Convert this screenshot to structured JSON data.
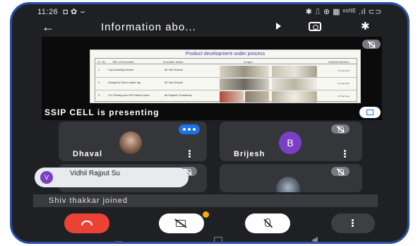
{
  "status_bar": {
    "time": "11:26",
    "left_icons": "◘ ✿ ⌣",
    "right_icons": "✱ ⎍ ⊕ ▦ ᵛᵒˡᵗᴱ .ıl ⊂⊃"
  },
  "app_bar": {
    "back_icon": "arrow-left",
    "title": "Information abo...",
    "icons": [
      "cast-icon",
      "switch-camera-icon",
      "bluetooth-icon"
    ]
  },
  "presentation": {
    "slide_title": "Product development under process",
    "slide_headers": [
      "Sr. No.",
      "Title of innovation",
      "Innovator Name",
      "Images",
      "Guided/ Mentors"
    ],
    "slide_rows": [
      {
        "no": "1",
        "title": "Cup washing Device",
        "innovator": "Mr Har Dhaval",
        "mentor": "Mr Raj Patel"
      },
      {
        "no": "2",
        "title": "Designed Storm water tap",
        "innovator": "Mr Har Dhaval",
        "mentor": "Mr Raj Patel"
      },
      {
        "no": "3",
        "title": "3 D Printing and 3D Printed parts",
        "innovator": "Mr Rajesh Chaudhary",
        "mentor": "Mr Raj Patel"
      }
    ],
    "presenter_label": "SSIP CELL is presenting"
  },
  "participants": [
    {
      "name": "Dhaval",
      "avatar": "photo"
    },
    {
      "name": "Brijesh",
      "avatar_letter": "B"
    },
    {
      "name": "",
      "avatar": "none"
    },
    {
      "name": "",
      "avatar": "photo"
    }
  ],
  "toast": {
    "avatar_letter": "V",
    "text": "Vidhil Rajput Su"
  },
  "joined_notice": "Shiv thakkar joined",
  "controls": [
    "end-call",
    "camera-off",
    "mic-off",
    "more-options"
  ],
  "colors": {
    "background": "#1f2023",
    "tile": "#35363a",
    "end_call": "#ea4335",
    "accent": "#1a73e8",
    "avatar_purple": "#7b3fc4",
    "alert": "#f9ab00"
  }
}
